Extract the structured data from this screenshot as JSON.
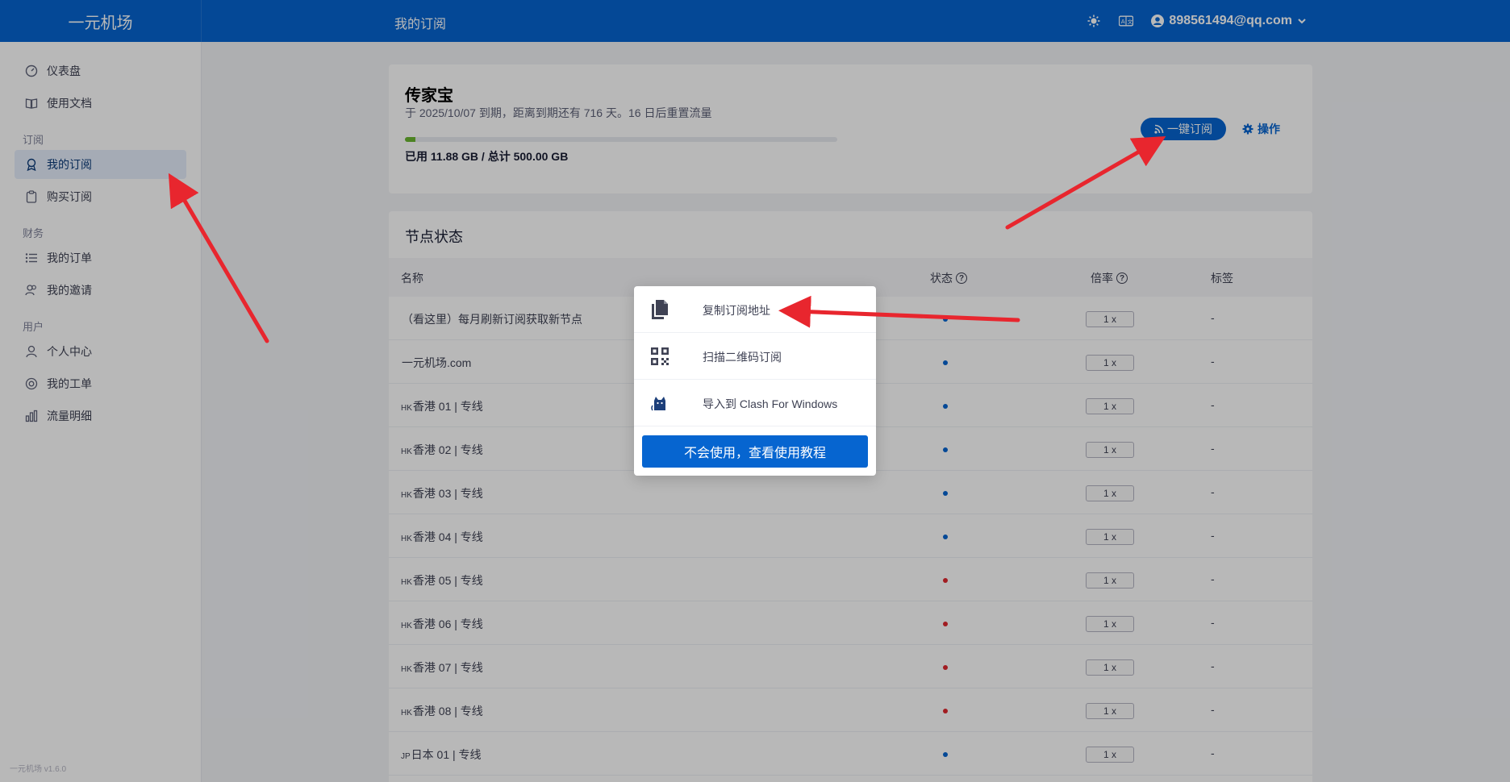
{
  "header": {
    "brand": "一元机场",
    "title": "我的订阅",
    "user_email": "898561494@qq.com"
  },
  "sidebar": {
    "sections": [
      {
        "label": "",
        "items": [
          {
            "label": "仪表盘",
            "icon": "dashboard-icon"
          },
          {
            "label": "使用文档",
            "icon": "book-icon"
          }
        ]
      },
      {
        "label": "订阅",
        "items": [
          {
            "label": "我的订阅",
            "icon": "subscription-icon",
            "active": true
          },
          {
            "label": "购买订阅",
            "icon": "clipboard-icon"
          }
        ]
      },
      {
        "label": "财务",
        "items": [
          {
            "label": "我的订单",
            "icon": "list-icon"
          },
          {
            "label": "我的邀请",
            "icon": "users-icon"
          }
        ]
      },
      {
        "label": "用户",
        "items": [
          {
            "label": "个人中心",
            "icon": "user-icon"
          },
          {
            "label": "我的工单",
            "icon": "support-icon"
          },
          {
            "label": "流量明细",
            "icon": "bar-chart-icon"
          }
        ]
      }
    ],
    "version": "一元机场 v1.6.0"
  },
  "plan": {
    "name": "传家宝",
    "expiry_text": "于 2025/10/07 到期，距离到期还有 716 天。16 日后重置流量",
    "usage_text": "已用 11.88 GB / 总计 500.00 GB",
    "usage_fraction": 0.024,
    "subscribe_button": "一键订阅",
    "operations_button": "操作"
  },
  "nodes": {
    "title": "节点状态",
    "columns": {
      "name": "名称",
      "status": "状态",
      "rate": "倍率",
      "tags": "标签"
    },
    "rows": [
      {
        "prefix": "",
        "name": "（看这里）每月刷新订阅获取新节点",
        "status": "online",
        "rate": "1 x",
        "tag": "-"
      },
      {
        "prefix": "",
        "name": "一元机场.com",
        "status": "online",
        "rate": "1 x",
        "tag": "-"
      },
      {
        "prefix": "HK",
        "name": "香港 01 | 专线",
        "status": "online",
        "rate": "1 x",
        "tag": "-"
      },
      {
        "prefix": "HK",
        "name": "香港 02 | 专线",
        "status": "online",
        "rate": "1 x",
        "tag": "-"
      },
      {
        "prefix": "HK",
        "name": "香港 03 | 专线",
        "status": "online",
        "rate": "1 x",
        "tag": "-"
      },
      {
        "prefix": "HK",
        "name": "香港 04 | 专线",
        "status": "online",
        "rate": "1 x",
        "tag": "-"
      },
      {
        "prefix": "HK",
        "name": "香港 05 | 专线",
        "status": "offline",
        "rate": "1 x",
        "tag": "-"
      },
      {
        "prefix": "HK",
        "name": "香港 06 | 专线",
        "status": "offline",
        "rate": "1 x",
        "tag": "-"
      },
      {
        "prefix": "HK",
        "name": "香港 07 | 专线",
        "status": "offline",
        "rate": "1 x",
        "tag": "-"
      },
      {
        "prefix": "HK",
        "name": "香港 08 | 专线",
        "status": "offline",
        "rate": "1 x",
        "tag": "-"
      },
      {
        "prefix": "JP",
        "name": "日本 01 | 专线",
        "status": "online",
        "rate": "1 x",
        "tag": "-"
      }
    ]
  },
  "popup": {
    "items": [
      {
        "label": "复制订阅地址",
        "icon": "copy-icon"
      },
      {
        "label": "扫描二维码订阅",
        "icon": "qrcode-icon"
      },
      {
        "label": "导入到 Clash For Windows",
        "icon": "clash-cat-icon"
      }
    ],
    "tutorial_button": "不会使用，查看使用教程"
  },
  "colors": {
    "primary": "#0665d0",
    "online": "#0665d0",
    "offline": "#e0282f",
    "annotation_arrow": "#e8262e",
    "progress": "#6ab630"
  }
}
